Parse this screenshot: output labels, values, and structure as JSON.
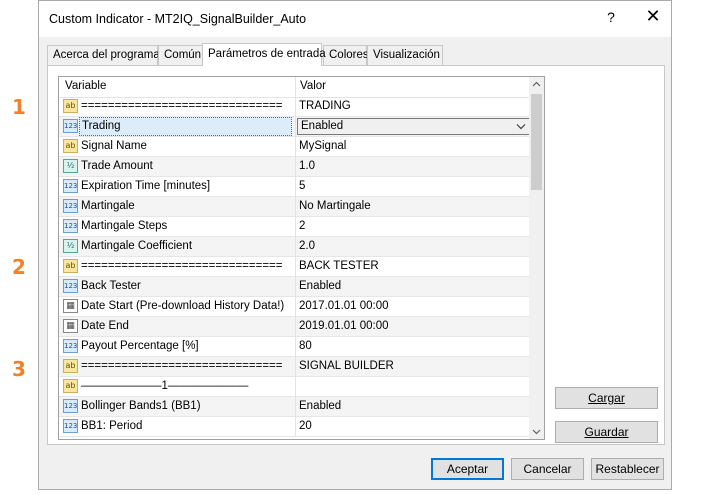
{
  "annotations": [
    "1",
    "2",
    "3"
  ],
  "window": {
    "title": "Custom Indicator - MT2IQ_SignalBuilder_Auto",
    "help_label": "?",
    "close_label": "✕"
  },
  "tabs": [
    {
      "label": "Acerca del programa"
    },
    {
      "label": "Común"
    },
    {
      "label": "Parámetros de entrada"
    },
    {
      "label": "Colores"
    },
    {
      "label": "Visualización"
    }
  ],
  "grid": {
    "headers": {
      "variable": "Variable",
      "value": "Valor"
    },
    "rows": [
      {
        "type": "ab",
        "name": "==============================",
        "value": "TRADING"
      },
      {
        "type": "123",
        "name": "Trading",
        "value": "Enabled"
      },
      {
        "type": "ab",
        "name": "Signal Name",
        "value": "MySignal"
      },
      {
        "type": "v2",
        "name": "Trade Amount",
        "value": "1.0"
      },
      {
        "type": "123",
        "name": "Expiration Time [minutes]",
        "value": "5"
      },
      {
        "type": "123",
        "name": "Martingale",
        "value": "No Martingale"
      },
      {
        "type": "123",
        "name": "Martingale Steps",
        "value": "2"
      },
      {
        "type": "v2",
        "name": "Martingale Coefficient",
        "value": "2.0"
      },
      {
        "type": "ab",
        "name": "==============================",
        "value": "BACK TESTER"
      },
      {
        "type": "123",
        "name": "Back Tester",
        "value": "Enabled"
      },
      {
        "type": "cal",
        "name": "Date Start (Pre-download History Data!)",
        "value": "2017.01.01 00:00"
      },
      {
        "type": "cal",
        "name": "Date End",
        "value": "2019.01.01 00:00"
      },
      {
        "type": "123",
        "name": "Payout Percentage [%]",
        "value": "80"
      },
      {
        "type": "ab",
        "name": "==============================",
        "value": "SIGNAL BUILDER"
      },
      {
        "type": "ab",
        "name": "———————1———————",
        "value": ""
      },
      {
        "type": "123",
        "name": "Bollinger Bands1 (BB1)",
        "value": "Enabled"
      },
      {
        "type": "123",
        "name": "BB1: Period",
        "value": "20"
      }
    ]
  },
  "side_buttons": {
    "load": "Cargar",
    "save": "Guardar"
  },
  "footer_buttons": {
    "accept": "Aceptar",
    "cancel": "Cancelar",
    "reset": "Restablecer"
  }
}
